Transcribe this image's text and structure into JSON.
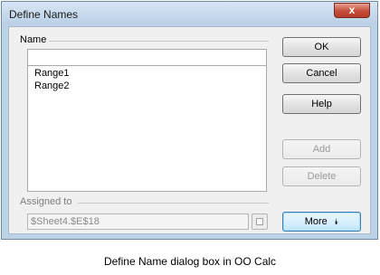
{
  "dialog": {
    "title": "Define Names",
    "close_glyph": "x"
  },
  "name_group": {
    "label": "Name",
    "input_value": "",
    "items": [
      "Range1",
      "Range2"
    ]
  },
  "assigned_group": {
    "label": "Assigned to",
    "value": "$Sheet4.$E$18",
    "shrink_icon": "shrink-icon"
  },
  "buttons": {
    "ok": "OK",
    "cancel": "Cancel",
    "help": "Help",
    "add": "Add",
    "delete": "Delete",
    "more": "More",
    "more_glyph": "⯯"
  },
  "caption": "Define Name dialog box in OO Calc"
}
